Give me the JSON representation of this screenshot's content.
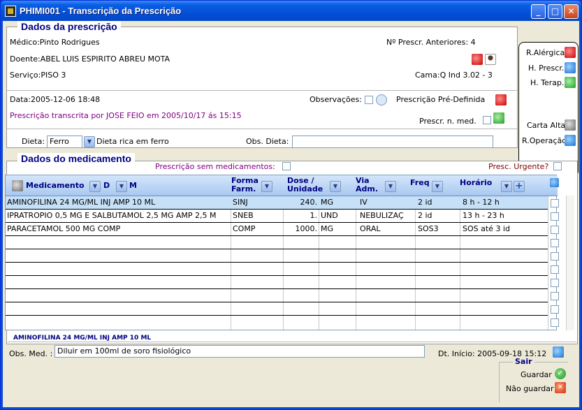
{
  "window": {
    "title": "PHIMI001 - Transcrição da Prescrição",
    "minimize_glyph": "_",
    "maximize_glyph": "□",
    "close_glyph": "✕"
  },
  "prescricao": {
    "section_title": "Dados da prescrição",
    "medico_label": "Médico:",
    "medico_value": "Pinto Rodrigues",
    "doente_label": "Doente:",
    "doente_value": "ABEL LUIS ESPIRITO ABREU MOTA",
    "servico_label": "Serviço:",
    "servico_value": "PISO 3",
    "anteriores_label": "Nº Prescr. Anteriores:",
    "anteriores_value": "4",
    "cama_label": "Cama:",
    "cama_value": "Q Ind 3.02 - 3",
    "data_label": "Data:",
    "data_value": "2005-12-06 18:48",
    "observacoes_label": "Observações:",
    "pre_definida_label": "Prescrição Pré-Definida",
    "transcrita_text": "Prescrição transcrita por JOSE FEIO em 2005/10/17 ás 15:15",
    "prescr_n_med_label": "Prescr. n. med.",
    "dieta_label": "Dieta:",
    "dieta_value": "Ferro",
    "dieta_desc": "Dieta rica em ferro",
    "obs_dieta_label": "Obs. Dieta:",
    "obs_dieta_value": ""
  },
  "sidebar": {
    "items": [
      {
        "label": "R.Alérgica",
        "icon": "allergy-icon"
      },
      {
        "label": "H. Prescr.",
        "icon": "prescription-history-icon"
      },
      {
        "label": "H. Terap.",
        "icon": "therapy-history-icon"
      },
      {
        "label": "Carta Alta",
        "icon": "discharge-letter-icon"
      },
      {
        "label": "R.Operação",
        "icon": "operation-record-icon"
      }
    ]
  },
  "medicamento": {
    "section_title": "Dados do medicamento",
    "sem_medicamentos_label": "Prescrição sem medicamentos:",
    "urgente_label": "Presc. Urgente?",
    "columns": {
      "medicamento": "Medicamento",
      "d": "D",
      "m": "M",
      "forma_1": "Forma",
      "forma_2": "Farm.",
      "dose_1": "Dose /",
      "dose_2": "Unidade",
      "via_1": "Via",
      "via_2": "Adm.",
      "freq": "Freq",
      "horario": "Horário",
      "add_glyph": "+"
    },
    "rows": [
      {
        "med": "AMINOFILINA 24 MG/ML INJ AMP 10 ML",
        "forma": "SINJ",
        "dose": "240.",
        "unidade": "MG",
        "via": "IV",
        "freq": "2 id",
        "horario": "8 h - 12 h"
      },
      {
        "med": "IPRATROPIO 0,5 MG  E SALBUTAMOL 2,5 MG AMP 2,5 M",
        "forma": "SNEB",
        "dose": "1.",
        "unidade": "UND",
        "via": "NEBULIZAÇ",
        "freq": "2 id",
        "horario": "13 h - 23 h"
      },
      {
        "med": "PARACETAMOL 500 MG COMP",
        "forma": "COMP",
        "dose": "1000.",
        "unidade": "MG",
        "via": "ORAL",
        "freq": "SOS3",
        "horario": "SOS até 3 id"
      }
    ],
    "selected_med": "AMINOFILINA 24 MG/ML INJ AMP 10 ML",
    "obs_med_label": "Obs. Med. :",
    "obs_med_value": "Diluir em 100ml de soro fisiológico",
    "dt_inicio_label": "Dt. Início:",
    "dt_inicio_value": "2005-09-18 15:12"
  },
  "sair": {
    "title": "Sair",
    "guardar": "Guardar",
    "nao_guardar": "Não guardar",
    "ok_glyph": "✓",
    "cancel_glyph": "✕"
  },
  "colors": {
    "accent": "#000080",
    "selected_row": "#c6e0f8",
    "purple_text": "#800080",
    "urgent_text": "#800000"
  }
}
